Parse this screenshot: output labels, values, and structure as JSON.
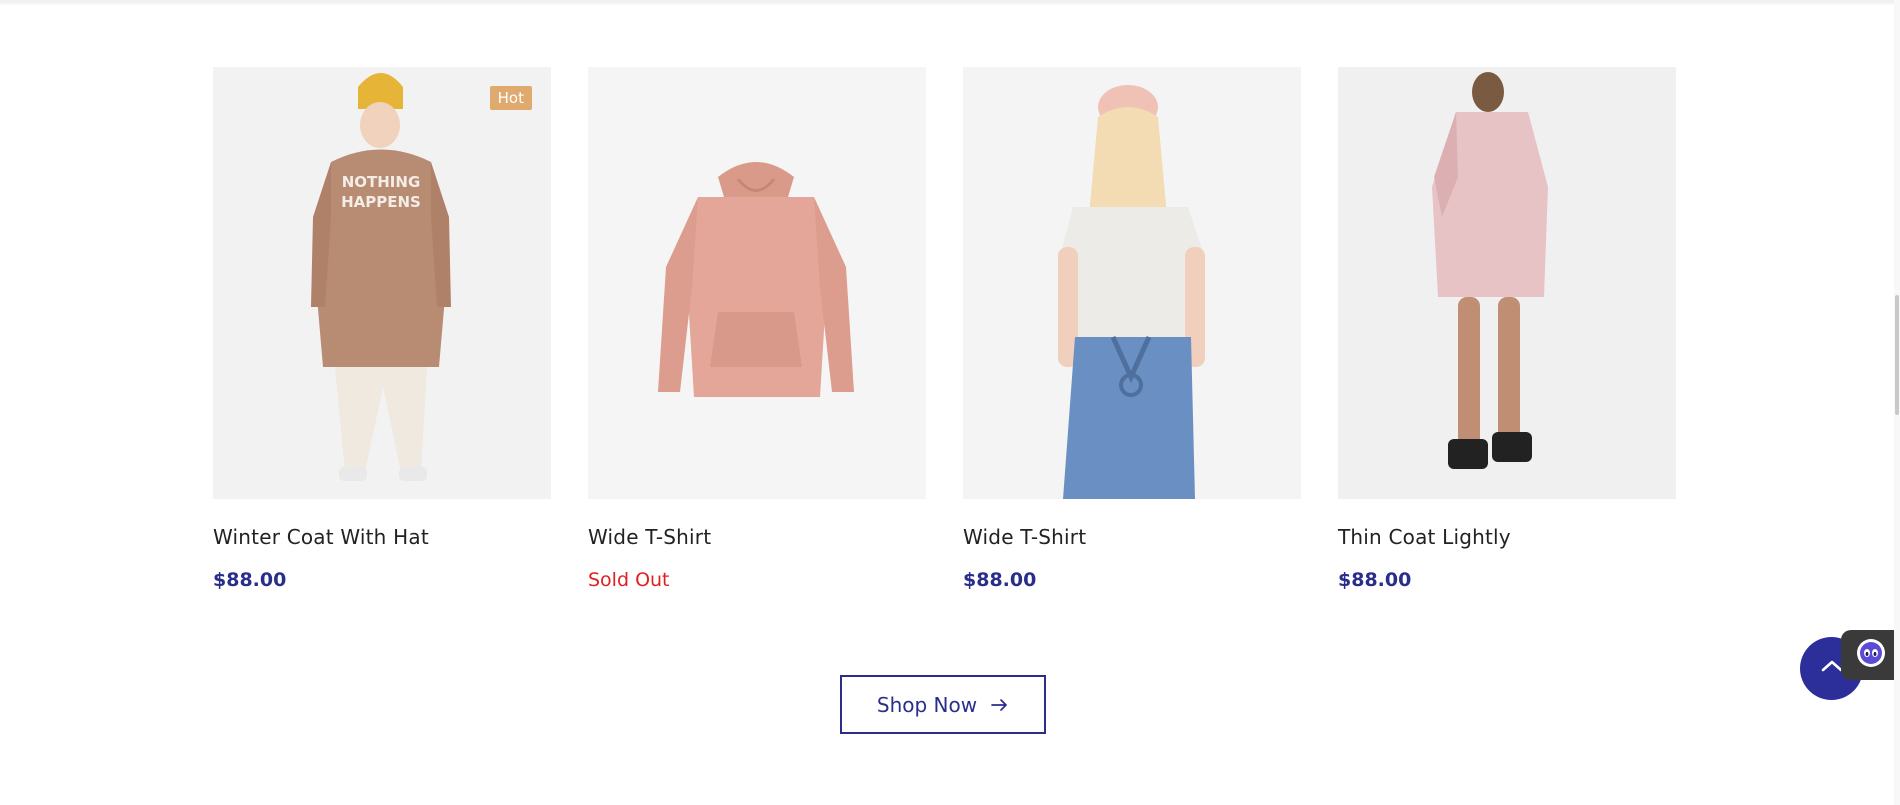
{
  "products": [
    {
      "name": "Winter Coat With Hat",
      "price": "$88.00",
      "badge": "Hot",
      "sold_out": false
    },
    {
      "name": "Wide T-Shirt",
      "price": "Sold Out",
      "badge": "",
      "sold_out": true
    },
    {
      "name": "Wide T-Shirt",
      "price": "$88.00",
      "badge": "",
      "sold_out": false
    },
    {
      "name": "Thin Coat Lightly",
      "price": "$88.00",
      "badge": "",
      "sold_out": false
    }
  ],
  "shop_button": {
    "label": "Shop Now",
    "icon": "arrow-right-icon"
  },
  "back_to_top": {
    "icon": "chevron-up-icon"
  },
  "chat": {
    "icon": "chatbot-icon"
  },
  "colors": {
    "accent": "#2a2e8a",
    "sold_out": "#e02020",
    "badge": "#e0a96d"
  }
}
